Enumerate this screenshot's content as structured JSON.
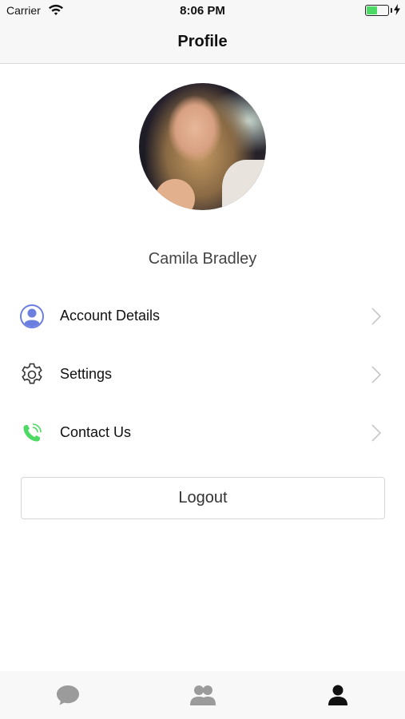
{
  "status_bar": {
    "carrier": "Carrier",
    "time": "8:06 PM",
    "battery_level": 0.45,
    "battery_color": "#4cd964"
  },
  "nav": {
    "title": "Profile"
  },
  "profile": {
    "name": "Camila Bradley"
  },
  "menu": {
    "items": [
      {
        "label": "Account Details",
        "icon": "user-circle-icon",
        "icon_color": "#6b7fe0"
      },
      {
        "label": "Settings",
        "icon": "gear-icon",
        "icon_color": "#333333"
      },
      {
        "label": "Contact Us",
        "icon": "phone-call-icon",
        "icon_color": "#4cd964"
      }
    ]
  },
  "logout": {
    "label": "Logout"
  },
  "tab_bar": {
    "tabs": [
      {
        "icon": "chat-bubble-icon",
        "active": false
      },
      {
        "icon": "contacts-icon",
        "active": false
      },
      {
        "icon": "profile-icon",
        "active": true
      }
    ],
    "active_color": "#111111",
    "inactive_color": "#9b9b9b"
  }
}
